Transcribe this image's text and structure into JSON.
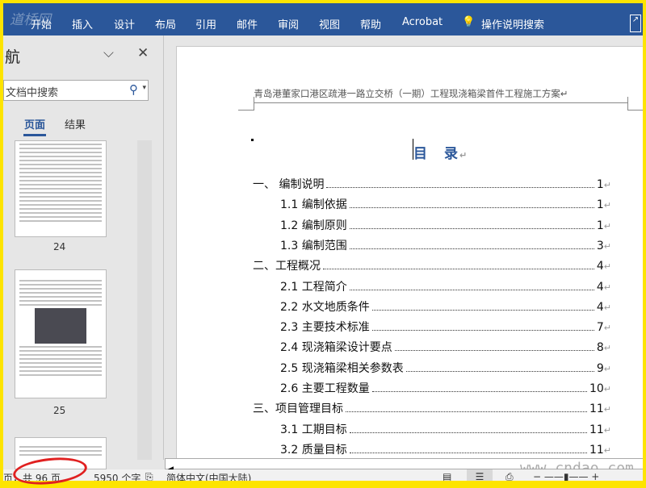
{
  "ribbon": {
    "logo": "道桥网",
    "tabs": [
      "开始",
      "插入",
      "设计",
      "布局",
      "引用",
      "邮件",
      "审阅",
      "视图",
      "帮助",
      "Acrobat"
    ],
    "tell_me": "操作说明搜索"
  },
  "nav": {
    "title": "航",
    "search_placeholder": "文档中搜索",
    "tabs": [
      "页面",
      "结果"
    ],
    "pages": [
      "24",
      "25"
    ]
  },
  "doc": {
    "header": "青岛港董家口港区疏港一路立交桥（一期）工程现浇箱梁首件工程施工方案↵",
    "toc_title": "目　录",
    "toc": [
      {
        "t": "一、 编制说明",
        "p": "1",
        "lvl": 0
      },
      {
        "t": "1.1 编制依据",
        "p": "1",
        "lvl": 1
      },
      {
        "t": "1.2 编制原则",
        "p": "1",
        "lvl": 1
      },
      {
        "t": "1.3 编制范围",
        "p": "3",
        "lvl": 1
      },
      {
        "t": "二、工程概况",
        "p": "4",
        "lvl": 0
      },
      {
        "t": "2.1 工程简介",
        "p": "4",
        "lvl": 1
      },
      {
        "t": "2.2 水文地质条件",
        "p": "4",
        "lvl": 1
      },
      {
        "t": "2.3 主要技术标准",
        "p": "7",
        "lvl": 1
      },
      {
        "t": "2.4 现浇箱梁设计要点",
        "p": "8",
        "lvl": 1
      },
      {
        "t": "2.5 现浇箱梁相关参数表",
        "p": "9",
        "lvl": 1
      },
      {
        "t": "2.6 主要工程数量",
        "p": "10",
        "lvl": 1
      },
      {
        "t": "三、项目管理目标",
        "p": "11",
        "lvl": 0
      },
      {
        "t": "3.1  工期目标",
        "p": "11",
        "lvl": 1
      },
      {
        "t": "3.2  质量目标",
        "p": "11",
        "lvl": 1
      }
    ]
  },
  "status": {
    "pages": "页，共 96 页",
    "words": "5950 个字",
    "language": "简体中文(中国大陆)",
    "watermark": "www.cndao.com"
  }
}
